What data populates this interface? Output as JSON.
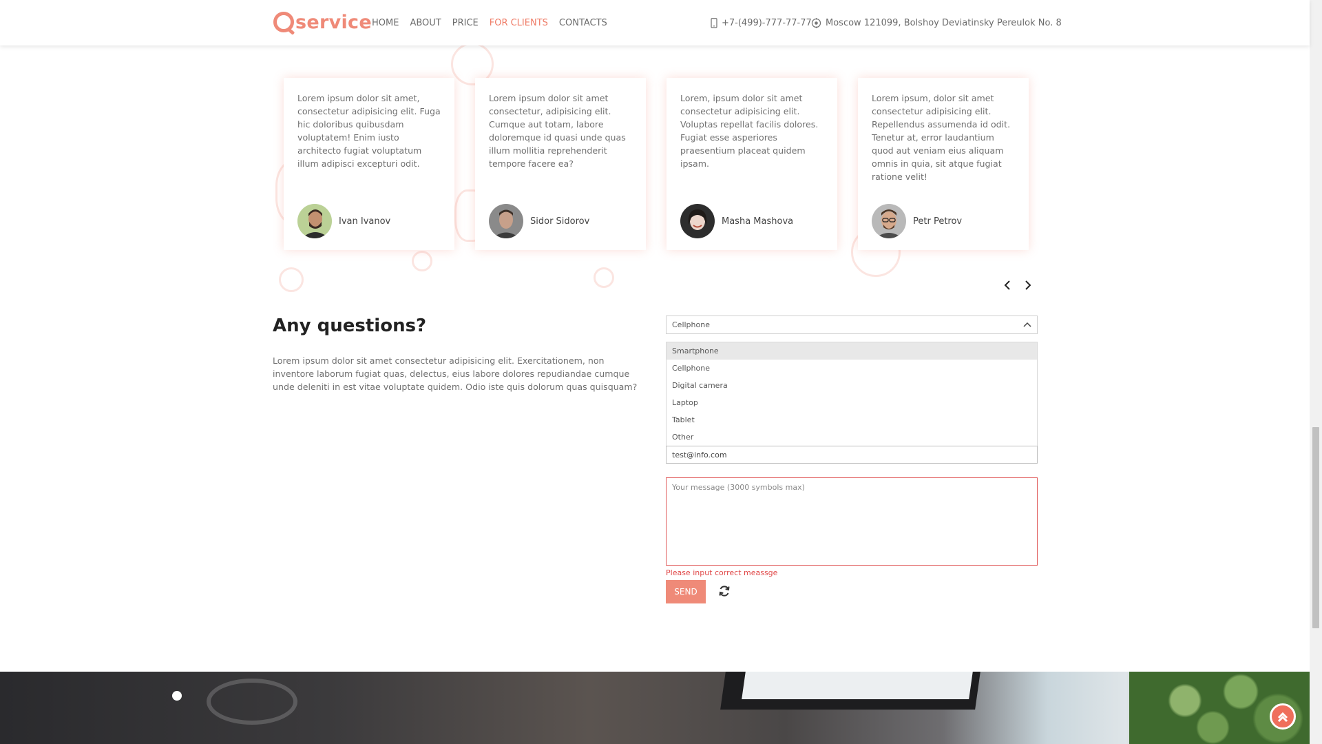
{
  "header": {
    "logo_text": "service",
    "nav": [
      {
        "label": "HOME",
        "active": false
      },
      {
        "label": "ABOUT",
        "active": false
      },
      {
        "label": "PRICE",
        "active": false
      },
      {
        "label": "FOR CLIENTS",
        "active": true
      },
      {
        "label": "CONTACTS",
        "active": false
      }
    ],
    "phone": "+7-(499)-777-77-77",
    "address": "Moscow 121099, Bolshoy Deviatinsky Pereulok No. 8"
  },
  "testimonials": [
    {
      "text": "Lorem ipsum dolor sit amet, consectetur adipisicing elit. Fuga hic doloribus quibusdam voluptatem! Enim iusto architecto fugiat voluptatum illum adipisci excepturi odit.",
      "name": "Ivan Ivanov"
    },
    {
      "text": "Lorem ipsum dolor sit amet consectetur, adipisicing elit. Cumque aut totam, labore doloremque id quasi unde quas illum mollitia reprehenderit tempore facere ea?",
      "name": "Sidor Sidorov"
    },
    {
      "text": "Lorem, ipsum dolor sit amet consectetur adipisicing elit. Voluptas repellat facilis dolores. Fugiat esse asperiores praesentium placeat quidem ipsam.",
      "name": "Masha Mashova"
    },
    {
      "text": "Lorem ipsum, dolor sit amet consectetur adipisicing elit. Repellendus assumenda id odit. Tenetur at, error laudantium quod aut veniam eius aliquam omnis in quia, sit atque fugiat ratione velit!",
      "name": "Petr Petrov"
    }
  ],
  "questions": {
    "title": "Any questions?",
    "text": "Lorem ipsum dolor sit amet consectetur adipisicing elit. Exercitationem, non inventore laborum fugiat quas, delectus, eius labore dolores repudiandae cumque unde deleniti in est vitae voluptate quidem. Odio iste quis dolorum quas quisquam?"
  },
  "form": {
    "device_selected": "Cellphone",
    "device_options": [
      "Smartphone",
      "Cellphone",
      "Digital camera",
      "Laptop",
      "Tablet",
      "Other"
    ],
    "email_value": "test@info.com",
    "message_placeholder": "Your message (3000 symbols max)",
    "error": "Please input correct meassge",
    "send_label": "SEND"
  },
  "colors": {
    "accent": "#ef8a78",
    "error": "#e04848"
  }
}
